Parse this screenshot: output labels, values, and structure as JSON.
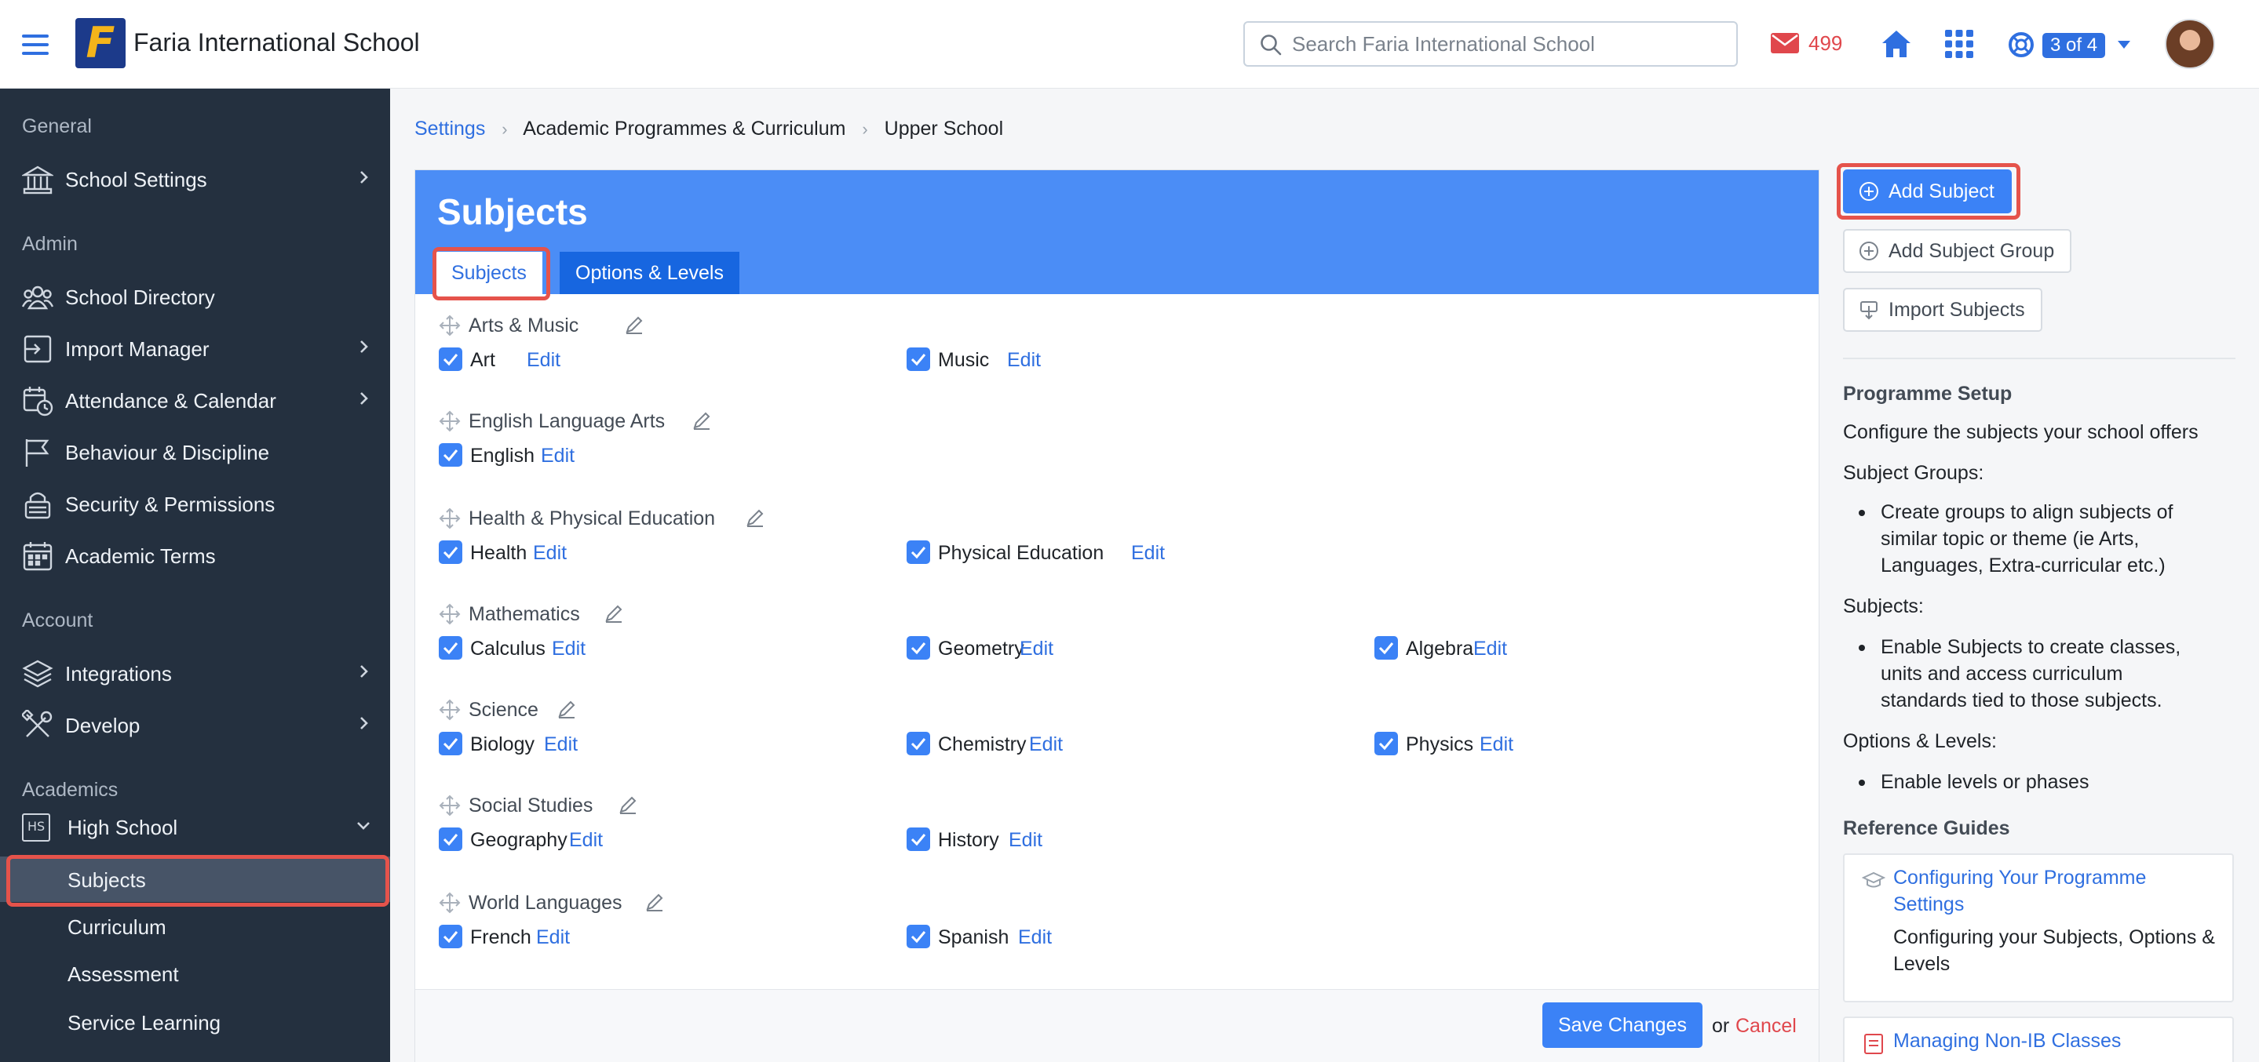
{
  "topbar": {
    "school_name": "Faria International School",
    "logo_letter": "F",
    "search_placeholder": "Search Faria International School",
    "mail_count": "499",
    "help_badge": "3 of 4",
    "icons": [
      "menu-icon",
      "search-icon",
      "mail-icon",
      "home-icon",
      "apps-grid-icon",
      "lifebuoy-icon",
      "caret-down-icon"
    ]
  },
  "sidebar": {
    "sections": {
      "general": "General",
      "admin": "Admin",
      "account": "Account",
      "academics": "Academics"
    },
    "items": [
      {
        "label": "School Settings",
        "icon": "building-icon",
        "chevron": true
      },
      {
        "label": "School Directory",
        "icon": "people-icon",
        "chevron": false
      },
      {
        "label": "Import Manager",
        "icon": "import-icon",
        "chevron": true
      },
      {
        "label": "Attendance & Calendar",
        "icon": "calendar-clock-icon",
        "chevron": true
      },
      {
        "label": "Behaviour & Discipline",
        "icon": "flag-icon",
        "chevron": false
      },
      {
        "label": "Security & Permissions",
        "icon": "lock-icon",
        "chevron": false
      },
      {
        "label": "Academic Terms",
        "icon": "calendar-icon",
        "chevron": false
      },
      {
        "label": "Integrations",
        "icon": "layers-icon",
        "chevron": true
      },
      {
        "label": "Develop",
        "icon": "tools-icon",
        "chevron": true
      }
    ],
    "high_school": {
      "badge": "HS",
      "label": "High School"
    },
    "sub_items": [
      "Subjects",
      "Curriculum",
      "Assessment",
      "Service Learning"
    ]
  },
  "breadcrumb": {
    "link": "Settings",
    "crumb1": "Academic Programmes & Curriculum",
    "crumb2": "Upper School"
  },
  "panel": {
    "title": "Subjects",
    "tabs": [
      "Subjects",
      "Options & Levels"
    ],
    "edit_label": "Edit",
    "groups": [
      {
        "name": "Arts & Music",
        "subjects": [
          "Art",
          "Music"
        ]
      },
      {
        "name": "English Language Arts",
        "subjects": [
          "English"
        ]
      },
      {
        "name": "Health & Physical Education",
        "subjects": [
          "Health",
          "Physical Education"
        ]
      },
      {
        "name": "Mathematics",
        "subjects": [
          "Calculus",
          "Geometry",
          "Algebra"
        ]
      },
      {
        "name": "Science",
        "subjects": [
          "Biology",
          "Chemistry",
          "Physics"
        ]
      },
      {
        "name": "Social Studies",
        "subjects": [
          "Geography",
          "History"
        ]
      },
      {
        "name": "World Languages",
        "subjects": [
          "French",
          "Spanish"
        ]
      }
    ],
    "footer": {
      "save": "Save Changes",
      "or": "or",
      "cancel": "Cancel"
    }
  },
  "right": {
    "add_subject": "Add Subject",
    "add_subject_group": "Add Subject Group",
    "import_subjects": "Import Subjects",
    "programme_setup": {
      "heading": "Programme Setup",
      "intro": "Configure the subjects your school offers",
      "groups_label": "Subject Groups:",
      "groups_bullet": "Create groups to align subjects of similar topic or theme (ie Arts, Languages, Extra-curricular etc.)",
      "subjects_label": "Subjects:",
      "subjects_bullet": "Enable Subjects to create classes, units and access curriculum standards tied to those subjects.",
      "options_label": "Options & Levels:",
      "options_bullet": "Enable levels or phases"
    },
    "reference": {
      "heading": "Reference Guides",
      "guide1_link": "Configuring Your Programme Settings",
      "guide1_desc": "Configuring your Subjects, Options & Levels",
      "guide2_link": "Managing Non-IB Classes"
    }
  },
  "colors": {
    "accent": "#2f6fe0",
    "header_blue": "#4b8df6",
    "sidebar_bg": "#24303f",
    "highlight": "#e5534b",
    "mail_red": "#e0474c"
  }
}
